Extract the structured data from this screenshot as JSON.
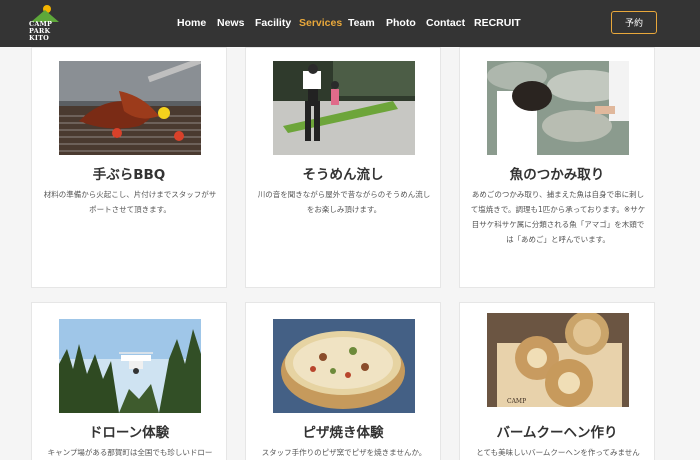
{
  "header": {
    "logo_lines": [
      "CAMP",
      "PARK",
      "KITO"
    ],
    "nav": [
      "Home",
      "News",
      "Facility",
      "Services",
      "Team",
      "Photo",
      "Contact",
      "RECRUIT"
    ],
    "active": "Services",
    "reserve_label": "予約"
  },
  "colors": {
    "header_bg": "#343434",
    "accent": "#e9a83b"
  },
  "cards": [
    {
      "title": "手ぶらBBQ",
      "desc": "材料の準備から火起こし、片付けまでスタッフがサポートさせて頂きます。"
    },
    {
      "title": "そうめん流し",
      "desc": "川の音を聞きながら屋外で昔ながらのそうめん流しをお楽しみ頂けます。"
    },
    {
      "title": "魚のつかみ取り",
      "desc": "あめごのつかみ取り、捕まえた魚は自身で串に刺して塩焼きで。調理も1匹から承っております。※サケ目サケ科サケ属に分類される魚「アマゴ」を木頭では「あめご」と呼んでいます。"
    },
    {
      "title": "ドローン体験",
      "desc": "キャンプ場がある那賀町は全国でも珍しいドロー"
    },
    {
      "title": "ピザ焼き体験",
      "desc": "スタッフ手作りのピザ窯でピザを焼きませんか。"
    },
    {
      "title": "バームクーヘン作り",
      "desc": "とても美味しいバームクーヘンを作ってみません"
    }
  ]
}
